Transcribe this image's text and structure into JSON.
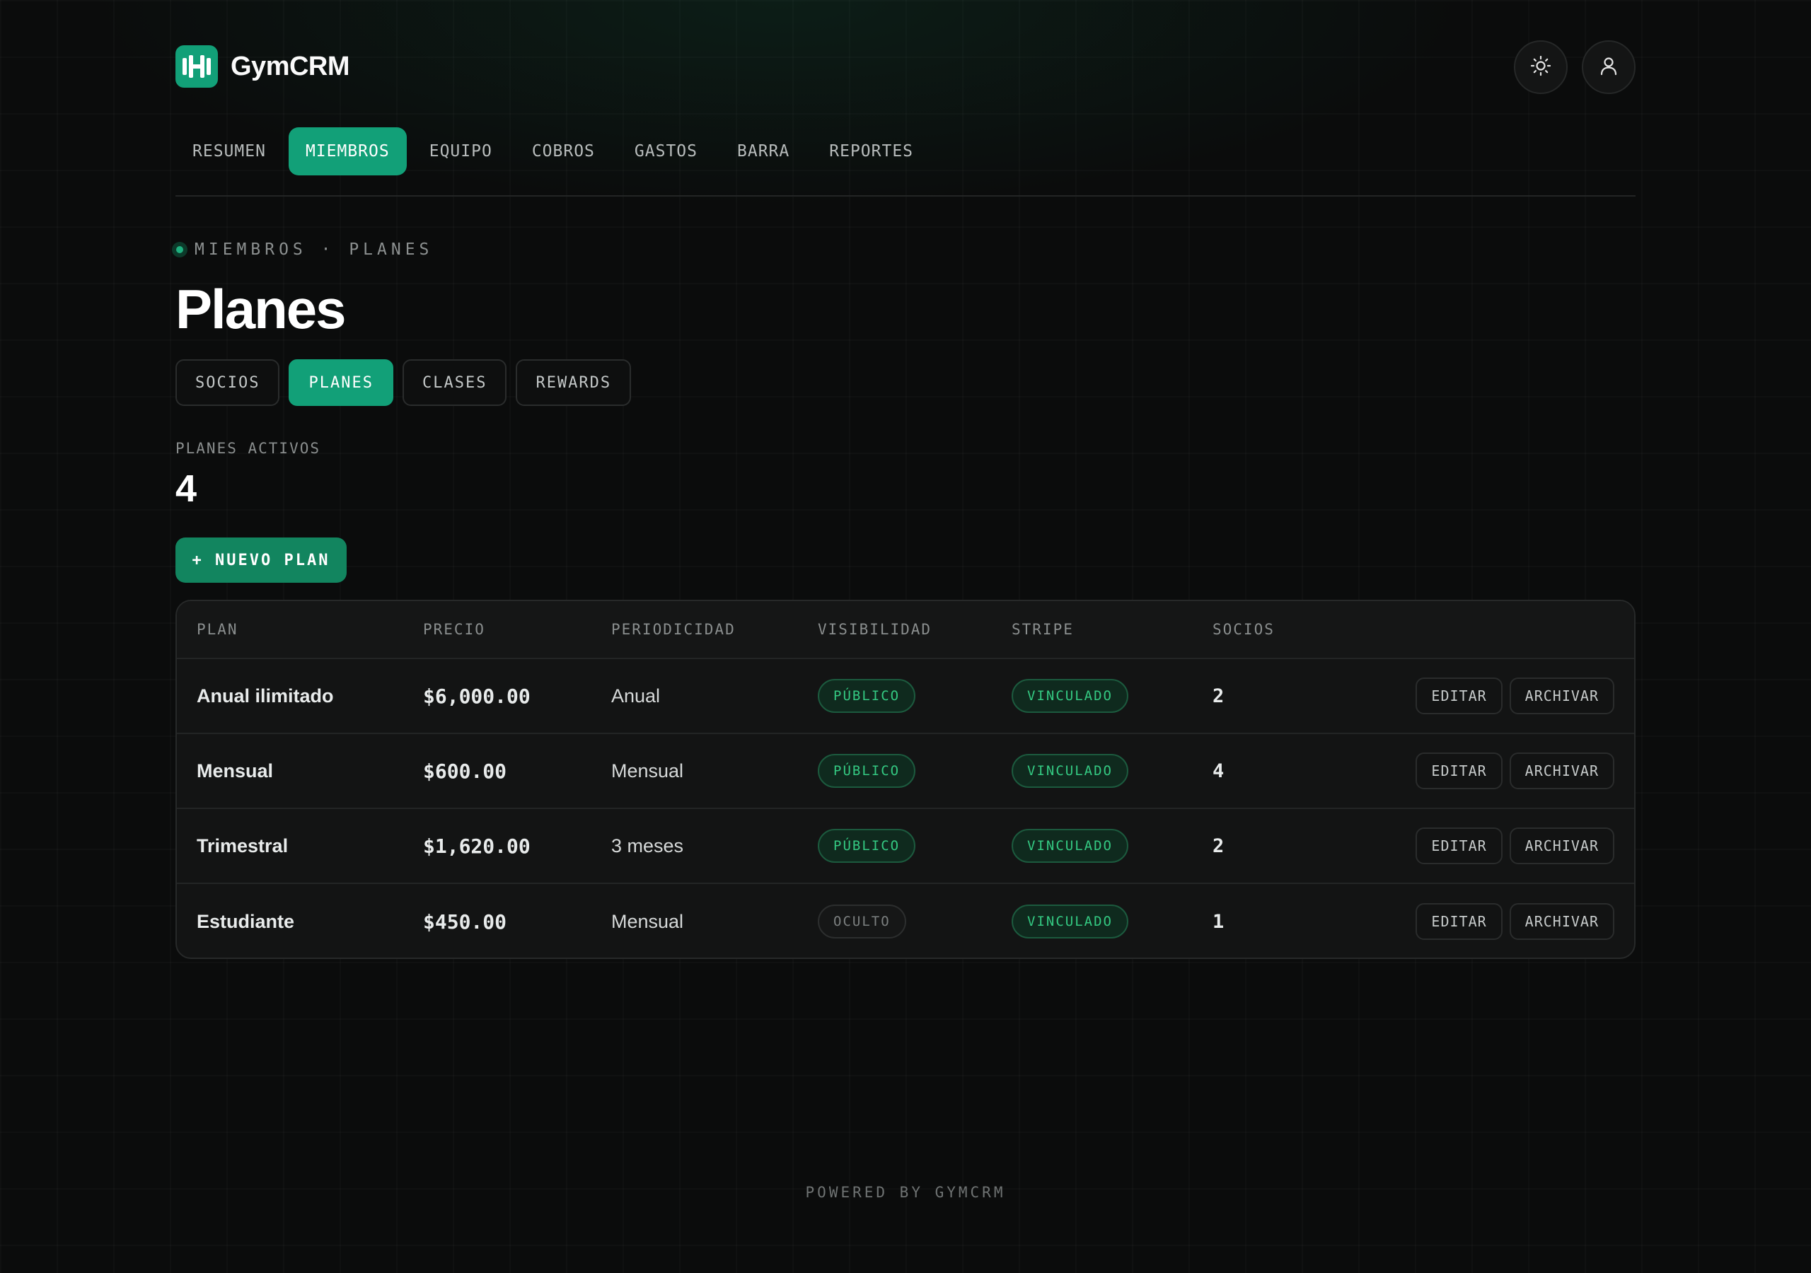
{
  "app": {
    "name": "GymCRM",
    "logo_icon": "dumbbell-icon",
    "accent": "#12a078"
  },
  "header": {
    "theme_icon": "sun-icon",
    "user_icon": "user-icon"
  },
  "nav": {
    "items": [
      {
        "label": "RESUMEN",
        "active": false
      },
      {
        "label": "MIEMBROS",
        "active": true
      },
      {
        "label": "EQUIPO",
        "active": false
      },
      {
        "label": "COBROS",
        "active": false
      },
      {
        "label": "GASTOS",
        "active": false
      },
      {
        "label": "BARRA",
        "active": false
      },
      {
        "label": "REPORTES",
        "active": false
      }
    ]
  },
  "breadcrumb": "MIEMBROS · PLANES",
  "page": {
    "title": "Planes"
  },
  "subtabs": [
    {
      "label": "SOCIOS",
      "active": false
    },
    {
      "label": "PLANES",
      "active": true
    },
    {
      "label": "CLASES",
      "active": false
    },
    {
      "label": "REWARDS",
      "active": false
    }
  ],
  "stat": {
    "label": "PLANES ACTIVOS",
    "value": "4"
  },
  "new_plan_button": "+ NUEVO PLAN",
  "table": {
    "headers": {
      "plan": "PLAN",
      "precio": "PRECIO",
      "periodicidad": "PERIODICIDAD",
      "visibilidad": "VISIBILIDAD",
      "stripe": "STRIPE",
      "socios": "SOCIOS"
    },
    "rows": [
      {
        "plan": "Anual ilimitado",
        "precio": "$6,000.00",
        "periodicidad": "Anual",
        "visibilidad": "PÚBLICO",
        "stripe": "VINCULADO",
        "socios": "2",
        "edit": "EDITAR",
        "archive": "ARCHIVAR"
      },
      {
        "plan": "Mensual",
        "precio": "$600.00",
        "periodicidad": "Mensual",
        "visibilidad": "PÚBLICO",
        "stripe": "VINCULADO",
        "socios": "4",
        "edit": "EDITAR",
        "archive": "ARCHIVAR"
      },
      {
        "plan": "Trimestral",
        "precio": "$1,620.00",
        "periodicidad": "3 meses",
        "visibilidad": "PÚBLICO",
        "stripe": "VINCULADO",
        "socios": "2",
        "edit": "EDITAR",
        "archive": "ARCHIVAR"
      },
      {
        "plan": "Estudiante",
        "precio": "$450.00",
        "periodicidad": "Mensual",
        "visibilidad": "OCULTO",
        "stripe": "VINCULADO",
        "socios": "1",
        "edit": "EDITAR",
        "archive": "ARCHIVAR"
      }
    ]
  },
  "footer": "POWERED BY GYMCRM"
}
